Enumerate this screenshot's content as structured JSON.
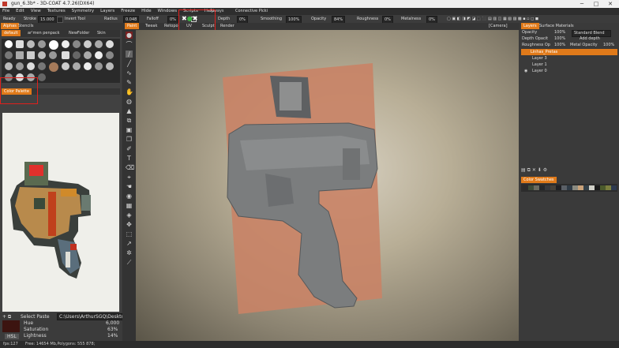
{
  "window": {
    "title": "gun_6.3b* - 3D-COAT 4.7.26(DX64)"
  },
  "menu": [
    "File",
    "Edit",
    "View",
    "Textures",
    "Symmetry",
    "Layers",
    "Freeze",
    "Hide",
    "Windows",
    "Scripts",
    "Help"
  ],
  "toolbar": {
    "ready": "Ready",
    "stroke_label": "Stroke",
    "stroke_value": "15.000",
    "invert_tool": "Invert Tool",
    "radius_label": "Radius",
    "radius_value": "0.048",
    "falloff_label": "Falloff",
    "falloff_value": "0%",
    "always": "Always",
    "connective": "Connective Picki",
    "depth_label": "Depth",
    "depth_value": "0%",
    "smoothing_label": "Smoothing",
    "smoothing_value": "100%",
    "opacity_label": "Opacity",
    "opacity_value": "84%",
    "roughness_label": "Roughness",
    "roughness_value": "0%",
    "metalness_label": "Metalness",
    "metalness_value": "0%"
  },
  "left_tabs": {
    "alphas": "Alphas",
    "stencils": "Stencils"
  },
  "brush_folders": [
    "default",
    "ar'men penpack",
    "NewFolder",
    "Skin"
  ],
  "room_tabs": [
    "Paint",
    "Tweak",
    "Retopo",
    "UV",
    "Sculpt",
    "Render"
  ],
  "camera": "[Camera]",
  "color_palette_tab": "Color Palette",
  "color_ctl": {
    "select_paste": "Select Paste",
    "path": "C:\\Users\\ArthurSGQ\\Desktop",
    "hue_label": "Hue",
    "hue_value": "6,000",
    "saturation_label": "Saturation",
    "saturation_value": "63%",
    "lightness_label": "Lightness",
    "lightness_value": "14%",
    "mode": "HSL"
  },
  "right": {
    "tabs": [
      "Layers",
      "Surface Materials"
    ],
    "opacity_label": "Opacity",
    "opacity_value": "100%",
    "blend_label": "Standard Blend",
    "depth_opacity_label": "Depth Opacit",
    "depth_opacity_value": "100%",
    "add_depth": "Add depth",
    "roughness_label": "Roughness Op",
    "roughness_value": "100%",
    "metal_label": "Metal Opacity",
    "metal_value": "100%",
    "layers": [
      "Linhas_Pretas",
      "Layer 3",
      "Layer 1",
      "Layer 0"
    ],
    "swatches_tab": "Color Swatches",
    "swatch_colors": [
      "#2b2b2b",
      "#3d4a38",
      "#6a6a60",
      "#23262a",
      "#34373c",
      "#44403a",
      "#1f2024",
      "#5a5f66",
      "#2f3b46",
      "#8a8a80",
      "#c9a27a",
      "#344048",
      "#d0d0c8",
      "#1a1a1a",
      "#4b5a2c",
      "#7b7f3e",
      "#2e3a50",
      "#9a7a5a"
    ]
  },
  "status": {
    "fps": "fps:127",
    "free": "Free: 14654 Mb,Polygons: 555 878;"
  },
  "colors": {
    "accent": "#e07a1a",
    "highlight": "#e0201c",
    "current_color": "#3c1410"
  }
}
